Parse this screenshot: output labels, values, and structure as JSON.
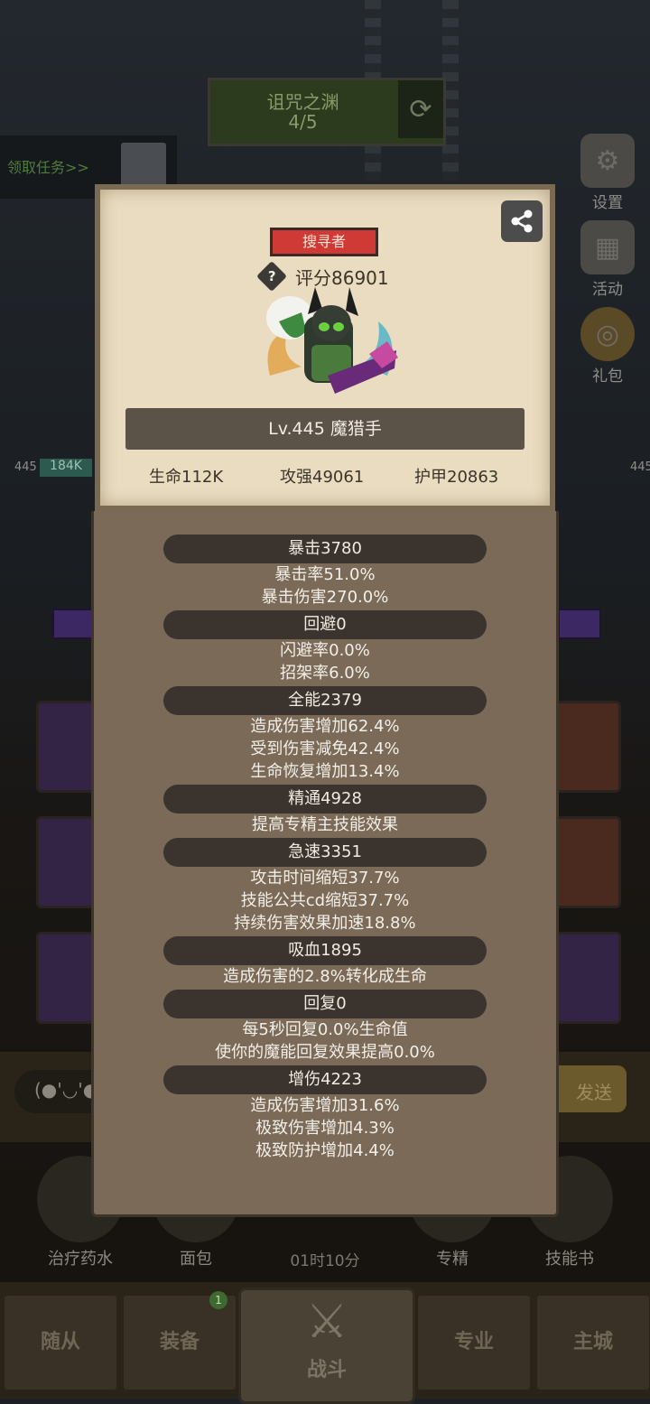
{
  "background": {
    "dungeon": {
      "title": "诅咒之渊",
      "progress": "4/5"
    },
    "quest_label": "领取任务>>",
    "side_buttons": [
      {
        "label": "设置",
        "icon": "gear-icon"
      },
      {
        "label": "活动",
        "icon": "calendar-icon"
      },
      {
        "label": "礼包",
        "icon": "gift-icon"
      }
    ],
    "left_level": "445",
    "left_hp": "184K",
    "right_level": "445",
    "chat_text": "(●'◡'●",
    "send_label": "发送",
    "items": [
      "治疗药水",
      "面包",
      "专精",
      "技能书"
    ],
    "timer": "01时10分",
    "nav": {
      "followers": "随从",
      "equipment": "装备",
      "battle": "战斗",
      "profession": "专业",
      "city": "主城",
      "badge": "1"
    }
  },
  "profile": {
    "class_badge": "搜寻者",
    "score": "评分86901",
    "name": "Lv.445 魔猎手",
    "hp": "生命112K",
    "attack": "攻强49061",
    "armor": "护甲20863"
  },
  "stats": [
    {
      "header": "暴击3780",
      "lines": [
        "暴击率51.0%",
        "暴击伤害270.0%"
      ]
    },
    {
      "header": "回避0",
      "lines": [
        "闪避率0.0%",
        "招架率6.0%"
      ]
    },
    {
      "header": "全能2379",
      "lines": [
        "造成伤害增加62.4%",
        "受到伤害减免42.4%",
        "生命恢复增加13.4%"
      ]
    },
    {
      "header": "精通4928",
      "lines": [
        "提高专精主技能效果"
      ]
    },
    {
      "header": "急速3351",
      "lines": [
        "攻击时间缩短37.7%",
        "技能公共cd缩短37.7%",
        "持续伤害效果加速18.8%"
      ]
    },
    {
      "header": "吸血1895",
      "lines": [
        "造成伤害的2.8%转化成生命"
      ]
    },
    {
      "header": "回复0",
      "lines": [
        "每5秒回复0.0%生命值",
        "使你的魔能回复效果提高0.0%"
      ]
    },
    {
      "header": "增伤4223",
      "lines": [
        "造成伤害增加31.6%",
        "极致伤害增加4.3%",
        "极致防护增加4.4%"
      ]
    }
  ]
}
